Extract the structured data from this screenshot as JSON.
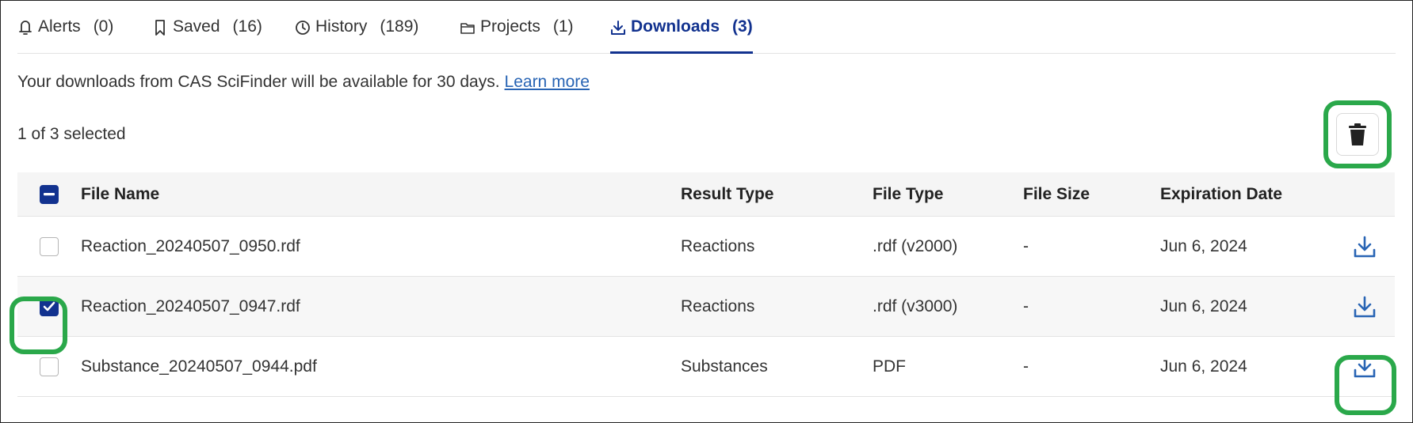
{
  "tabs": [
    {
      "label": "Alerts",
      "count": "(0)",
      "icon": "bell-icon"
    },
    {
      "label": "Saved",
      "count": "(16)",
      "icon": "bookmark-icon"
    },
    {
      "label": "History",
      "count": "(189)",
      "icon": "clock-icon"
    },
    {
      "label": "Projects",
      "count": "(1)",
      "icon": "folder-icon"
    },
    {
      "label": "Downloads",
      "count": "(3)",
      "icon": "download-icon",
      "active": true
    }
  ],
  "notice": {
    "text": "Your downloads from CAS SciFinder will be available for 30 days.",
    "link": "Learn more"
  },
  "selection": {
    "text": "1 of 3 selected"
  },
  "table": {
    "headers": {
      "file_name": "File Name",
      "result_type": "Result Type",
      "file_type": "File Type",
      "file_size": "File Size",
      "expiration": "Expiration Date"
    },
    "rows": [
      {
        "file_name": "Reaction_20240507_0950.rdf",
        "result_type": "Reactions",
        "file_type": ".rdf (v2000)",
        "file_size": "-",
        "expiration": "Jun 6, 2024",
        "checked": false
      },
      {
        "file_name": "Reaction_20240507_0947.rdf",
        "result_type": "Reactions",
        "file_type": ".rdf (v3000)",
        "file_size": "-",
        "expiration": "Jun 6, 2024",
        "checked": true
      },
      {
        "file_name": "Substance_20240507_0944.pdf",
        "result_type": "Substances",
        "file_type": "PDF",
        "file_size": "-",
        "expiration": "Jun 6, 2024",
        "checked": false
      }
    ]
  },
  "colors": {
    "accent": "#12328f",
    "link": "#2864b4",
    "highlight": "#2aa84a"
  }
}
